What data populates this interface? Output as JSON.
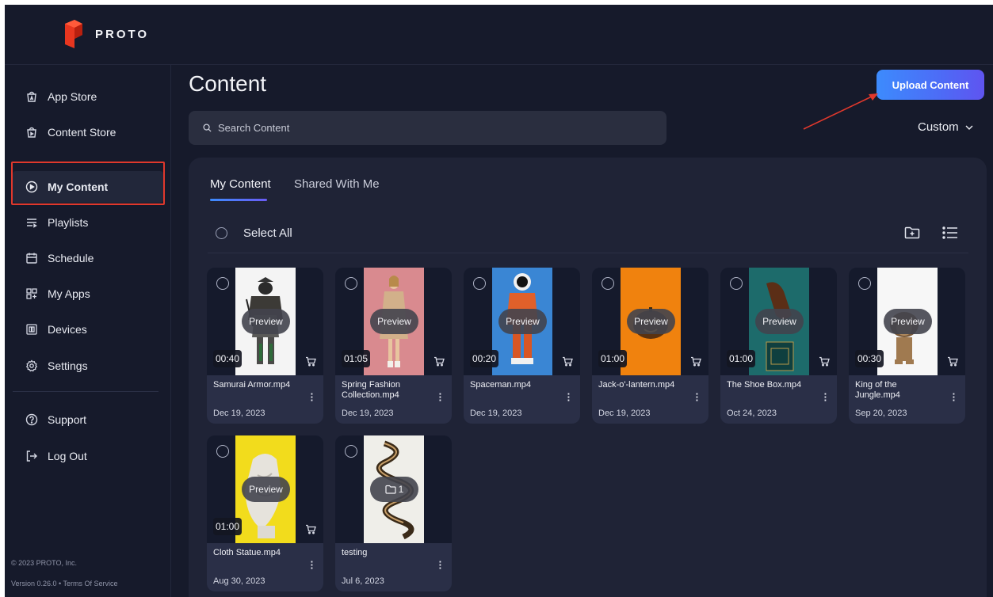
{
  "app": {
    "brand": "PROTO"
  },
  "sidebar": {
    "items": [
      {
        "label": "App Store",
        "icon": "app-store-icon"
      },
      {
        "label": "Content Store",
        "icon": "content-store-icon"
      },
      {
        "label": "My Content",
        "icon": "play-circle-icon",
        "active": true
      },
      {
        "label": "Playlists",
        "icon": "playlist-icon"
      },
      {
        "label": "Schedule",
        "icon": "calendar-icon"
      },
      {
        "label": "My Apps",
        "icon": "apps-grid-icon"
      },
      {
        "label": "Devices",
        "icon": "devices-icon"
      },
      {
        "label": "Settings",
        "icon": "gear-icon"
      },
      {
        "label": "Support",
        "icon": "help-icon"
      },
      {
        "label": "Log Out",
        "icon": "logout-icon"
      }
    ],
    "copyright": "© 2023 PROTO, Inc.",
    "version": "Version 0.26.0 • Terms Of Service"
  },
  "header": {
    "title": "Content",
    "upload_label": "Upload Content",
    "search_placeholder": "Search Content",
    "sort_label": "Custom"
  },
  "tabs": [
    {
      "label": "My Content",
      "active": true
    },
    {
      "label": "Shared With Me",
      "active": false
    }
  ],
  "select_all_label": "Select All",
  "cards": [
    {
      "name": "Samurai Armor.mp4",
      "date": "Dec 19, 2023",
      "duration": "00:40",
      "overlay": "Preview"
    },
    {
      "name": "Spring Fashion Collection.mp4",
      "date": "Dec 19, 2023",
      "duration": "01:05",
      "overlay": "Preview"
    },
    {
      "name": "Spaceman.mp4",
      "date": "Dec 19, 2023",
      "duration": "00:20",
      "overlay": "Preview"
    },
    {
      "name": "Jack-o'-lantern.mp4",
      "date": "Dec 19, 2023",
      "duration": "01:00",
      "overlay": "Preview"
    },
    {
      "name": "The Shoe Box.mp4",
      "date": "Oct 24, 2023",
      "duration": "01:00",
      "overlay": "Preview"
    },
    {
      "name": "King of the Jungle.mp4",
      "date": "Sep 20, 2023",
      "duration": "00:30",
      "overlay": "Preview"
    },
    {
      "name": "Cloth Statue.mp4",
      "date": "Aug 30, 2023",
      "duration": "01:00",
      "overlay": "Preview"
    },
    {
      "name": "testing",
      "date": "Jul 6, 2023",
      "folder_count": "1"
    }
  ],
  "colors": {
    "background": "#161a2b",
    "panel": "#1f2336",
    "accent": "#3d8bfd",
    "annotation": "#e0382c"
  }
}
